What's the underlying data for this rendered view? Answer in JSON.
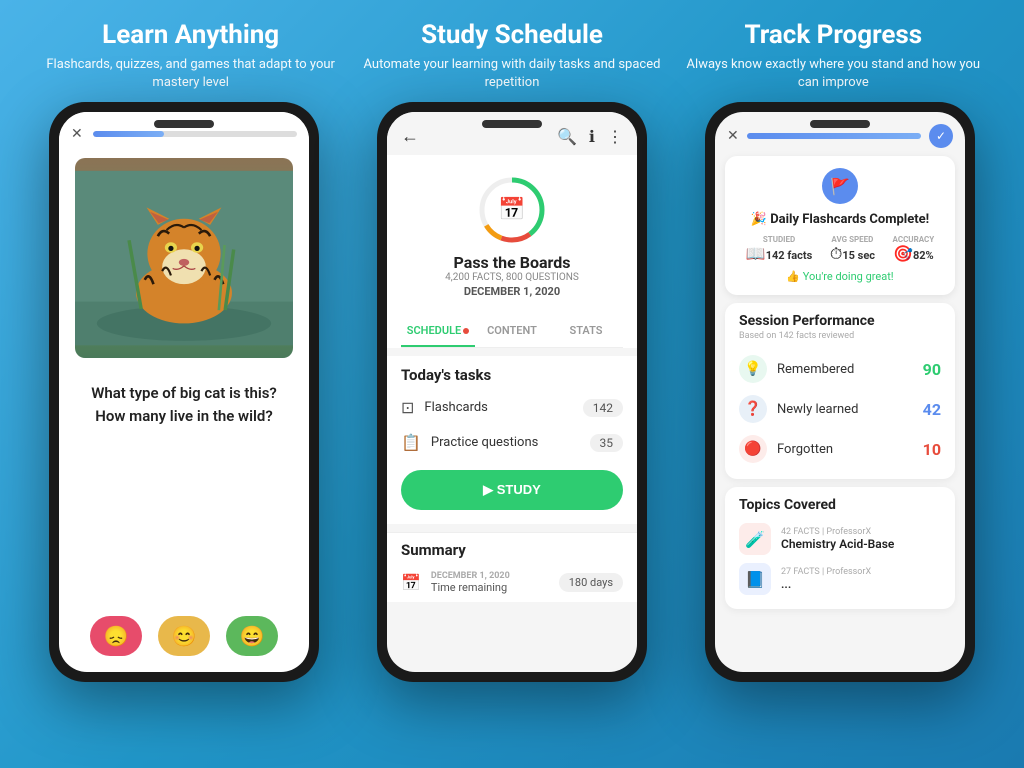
{
  "columns": [
    {
      "id": "learn",
      "title": "Learn Anything",
      "subtitle": "Flashcards, quizzes, and games\nthat adapt to your mastery level",
      "phone": {
        "question_line1": "What type of big cat is this?",
        "question_line2": "How many live in the wild?",
        "buttons": [
          {
            "icon": "😞",
            "color": "#e74c6b"
          },
          {
            "icon": "😊",
            "color": "#e8b84b"
          },
          {
            "icon": "😄",
            "color": "#5cb85c"
          }
        ]
      }
    },
    {
      "id": "study",
      "title": "Study Schedule",
      "subtitle": "Automate your learning with daily\ntasks and spaced repetition",
      "phone": {
        "deck_title": "Pass the Boards",
        "deck_facts": "4,200 FACTS, 800 QUESTIONS",
        "deck_date": "DECEMBER 1, 2020",
        "tabs": [
          "SCHEDULE",
          "CONTENT",
          "STATS"
        ],
        "active_tab": "SCHEDULE",
        "tasks_title": "Today's tasks",
        "tasks": [
          {
            "label": "Flashcards",
            "count": "142"
          },
          {
            "label": "Practice questions",
            "count": "35"
          }
        ],
        "study_btn": "▶ STUDY",
        "summary_title": "Summary",
        "summary_date": "DECEMBER 1, 2020",
        "summary_label": "Time remaining",
        "summary_value": "180 days"
      }
    },
    {
      "id": "track",
      "title": "Track Progress",
      "subtitle": "Always know exactly where you\nstand and how you can improve",
      "phone": {
        "complete_title": "🎉 Daily Flashcards Complete!",
        "stats": [
          {
            "icon": "📖",
            "label": "STUDIED",
            "value": "142 facts"
          },
          {
            "icon": "⏱",
            "label": "AVG SPEED",
            "value": "15 sec"
          },
          {
            "icon": "🎯",
            "label": "ACCURACY",
            "value": "82%"
          }
        ],
        "great_text": "👍 You're doing great!",
        "session_title": "Session Performance",
        "session_sub": "Based on 142 facts reviewed",
        "performance": [
          {
            "label": "Remembered",
            "value": "90",
            "color": "green"
          },
          {
            "label": "Newly learned",
            "value": "42",
            "color": "blue"
          },
          {
            "label": "Forgotten",
            "value": "10",
            "color": "red"
          }
        ],
        "topics_title": "Topics Covered",
        "topics": [
          {
            "facts": "42 FACTS | ProfessorX",
            "name": "Chemistry Acid-Base"
          },
          {
            "facts": "27 FACTS | ProfessorX",
            "name": "..."
          }
        ]
      }
    }
  ]
}
